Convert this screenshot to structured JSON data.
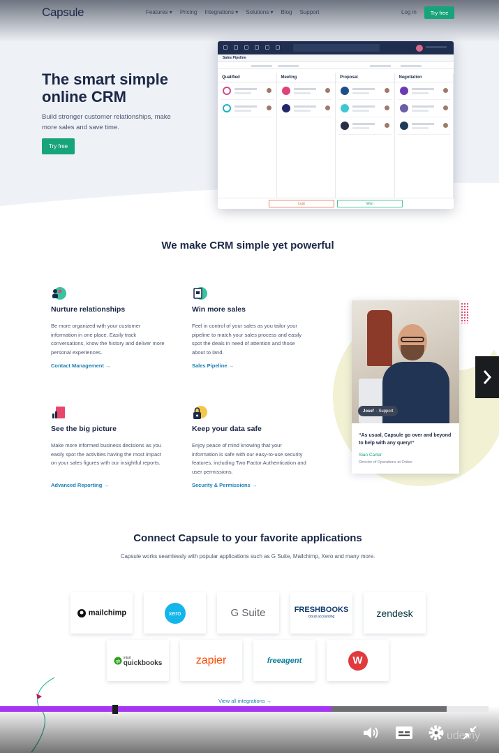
{
  "nav": {
    "logo": "Capsule",
    "links": [
      "Features ▾",
      "Pricing",
      "Integrations ▾",
      "Solutions ▾",
      "Blog",
      "Support"
    ],
    "login": "Log in",
    "try_free": "Try free"
  },
  "hero": {
    "title": "The smart simple online CRM",
    "subtitle": "Build stronger customer relationships, make more sales and save time.",
    "cta": "Try free"
  },
  "app": {
    "subheader": "Sales Pipeline",
    "columns": [
      "Qualified",
      "Meeting",
      "Proposal",
      "Negotiation"
    ],
    "lost": "Lost",
    "won": "Won",
    "colors": {
      "nav": "#1f2d4e",
      "lost": "#d2553a",
      "won": "#1e9e77"
    }
  },
  "section": {
    "title": "We make CRM simple yet powerful"
  },
  "features": [
    {
      "title": "Nurture relationships",
      "text": "Be more organized with your customer information in one place. Easily track conversations, know the history and deliver more personal experiences.",
      "link": "Contact Management →",
      "icon": "people-icon"
    },
    {
      "title": "Win more sales",
      "text": "Feel in control of your sales as you tailor your pipeline to match your sales process and easily spot the deals in need of attention and those about to land.",
      "link": "Sales Pipeline →",
      "icon": "pipeline-icon"
    },
    {
      "title": "See the big picture",
      "text": "Make more informed business decisions as you easily spot the activities having the most impact on your sales figures with our insightful reports.",
      "link": "Advanced Reporting →",
      "icon": "chart-icon"
    },
    {
      "title": "Keep your data safe",
      "text": "Enjoy peace of mind knowing that your information is safe with our easy-to-use security features, including Two Factor Authentication and user permissions.",
      "link": "Security & Permissions →",
      "icon": "lock-icon"
    }
  ],
  "testimonial": {
    "tag_name": "Josef",
    "tag_role": "· Support",
    "quote": "“As usual, Capsule go over and beyond to help with any query!”",
    "name": "Sian Carter",
    "role": "Director of Operations at Ordoo"
  },
  "integrations": {
    "title": "Connect Capsule to your favorite applications",
    "subtitle": "Capsule works seamlessly with popular applications such as G Suite, Mailchimp, Xero and many more.",
    "apps": [
      "mailchimp",
      "xero",
      "G Suite",
      "FRESHBOOKS",
      "zendesk",
      "quickbooks",
      "zapier",
      "freeagent",
      "W"
    ],
    "app_sub": {
      "freshbooks": "cloud accounting",
      "quickbooks": "intuit"
    },
    "view_all": "View all integrations →"
  },
  "player": {
    "progress": 0.679,
    "buffered": 0.914,
    "colors": {
      "played": "#a435f0",
      "buffered": "#6d6e72"
    },
    "watermark": "udemy",
    "controls": [
      "volume-icon",
      "captions-icon",
      "settings-icon",
      "exit-fullscreen-icon"
    ]
  }
}
